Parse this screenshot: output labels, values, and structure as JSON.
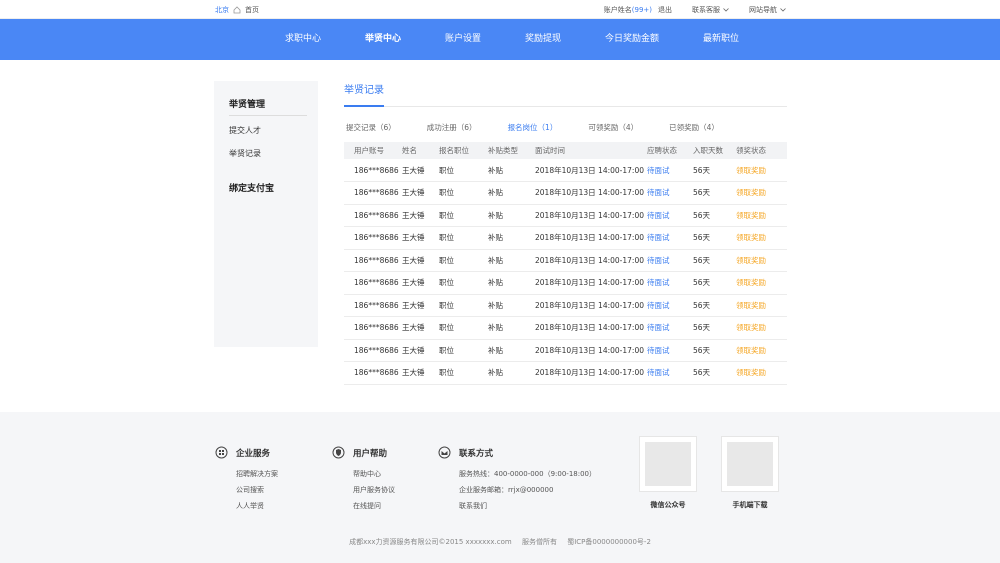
{
  "topbar": {
    "city": "北京",
    "home": "首页",
    "account": "账户姓名",
    "account_badge": "(99+)",
    "logout": "退出",
    "service": "联系客服",
    "sitenav": "网站导航"
  },
  "nav": {
    "items": [
      {
        "label": "求职中心",
        "active": false
      },
      {
        "label": "举贤中心",
        "active": true
      },
      {
        "label": "账户设置",
        "active": false
      },
      {
        "label": "奖励提现",
        "active": false
      },
      {
        "label": "今日奖励金额",
        "active": false
      },
      {
        "label": "最新职位",
        "active": false
      }
    ]
  },
  "sidebar": {
    "group1": "举贤管理",
    "item1": "提交人才",
    "item2": "举贤记录",
    "group2": "绑定支付宝"
  },
  "content": {
    "title": "举贤记录",
    "tabs": [
      {
        "label": "提交记录（6）",
        "active": false
      },
      {
        "label": "成功注册（6）",
        "active": false
      },
      {
        "label": "报名岗位（1）",
        "active": true
      },
      {
        "label": "可领奖励（4）",
        "active": false
      },
      {
        "label": "已领奖励（4）",
        "active": false
      }
    ],
    "columns": [
      "用户账号",
      "姓名",
      "报名职位",
      "补贴类型",
      "面试时间",
      "应聘状态",
      "入职天数",
      "领奖状态"
    ],
    "rows": [
      [
        "186***8686",
        "王大锤",
        "职位",
        "补贴",
        "2018年10月13日 14:00-17:00",
        "待面试",
        "56天",
        "领取奖励"
      ],
      [
        "186***8686",
        "王大锤",
        "职位",
        "补贴",
        "2018年10月13日 14:00-17:00",
        "待面试",
        "56天",
        "领取奖励"
      ],
      [
        "186***8686",
        "王大锤",
        "职位",
        "补贴",
        "2018年10月13日 14:00-17:00",
        "待面试",
        "56天",
        "领取奖励"
      ],
      [
        "186***8686",
        "王大锤",
        "职位",
        "补贴",
        "2018年10月13日 14:00-17:00",
        "待面试",
        "56天",
        "领取奖励"
      ],
      [
        "186***8686",
        "王大锤",
        "职位",
        "补贴",
        "2018年10月13日 14:00-17:00",
        "待面试",
        "56天",
        "领取奖励"
      ],
      [
        "186***8686",
        "王大锤",
        "职位",
        "补贴",
        "2018年10月13日 14:00-17:00",
        "待面试",
        "56天",
        "领取奖励"
      ],
      [
        "186***8686",
        "王大锤",
        "职位",
        "补贴",
        "2018年10月13日 14:00-17:00",
        "待面试",
        "56天",
        "领取奖励"
      ],
      [
        "186***8686",
        "王大锤",
        "职位",
        "补贴",
        "2018年10月13日 14:00-17:00",
        "待面试",
        "56天",
        "领取奖励"
      ],
      [
        "186***8686",
        "王大锤",
        "职位",
        "补贴",
        "2018年10月13日 14:00-17:00",
        "待面试",
        "56天",
        "领取奖励"
      ],
      [
        "186***8686",
        "王大锤",
        "职位",
        "补贴",
        "2018年10月13日 14:00-17:00",
        "待面试",
        "56天",
        "领取奖励"
      ]
    ]
  },
  "footer": {
    "enterprise": {
      "title": "企业服务",
      "links": [
        "招聘解决方案",
        "公司搜索",
        "人人举贤"
      ]
    },
    "help": {
      "title": "用户帮助",
      "links": [
        "帮助中心",
        "用户服务协议",
        "在线提问"
      ]
    },
    "contact": {
      "title": "联系方式",
      "links": [
        "服务热线：400-0000-000（9:00-18:00）",
        "企业服务邮箱：rrjx@000000",
        "联系我们"
      ]
    },
    "qr1": "微信公众号",
    "qr2": "手机端下载",
    "copyright": "成都xxx力资源服务有限公司©2015 xxxxxxx.com",
    "rights": "服务僧所有",
    "icp": "蜀ICP备0000000000号-2"
  },
  "colors": {
    "accent": "#4a87f5",
    "link": "#3a7cf0",
    "reward": "#f5a623"
  }
}
